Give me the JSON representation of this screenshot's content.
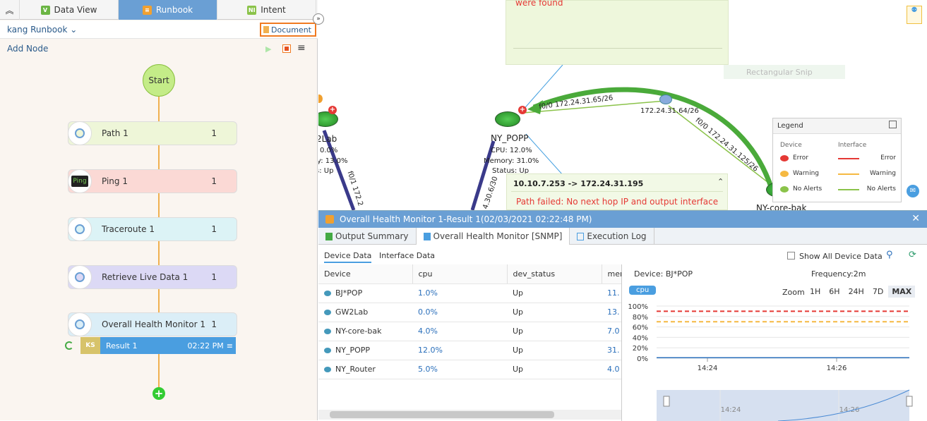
{
  "tabs": [
    {
      "label": "Data View",
      "icon": "V"
    },
    {
      "label": "Runbook",
      "icon": "≡"
    },
    {
      "label": "Intent",
      "icon": "NI"
    }
  ],
  "runbook": {
    "name": "kang Runbook",
    "document_label": "Document",
    "add_node_label": "Add Node",
    "start_label": "Start",
    "nodes": [
      {
        "label": "Path 1",
        "count": "1",
        "color": "#eef6d8",
        "icon": "path-icon"
      },
      {
        "label": "Ping 1",
        "count": "1",
        "color": "#fbd9d5",
        "icon": "ping-icon",
        "icon_text": "Ping"
      },
      {
        "label": "Traceroute 1",
        "count": "1",
        "color": "#dcf3f6",
        "icon": "traceroute-icon"
      },
      {
        "label": "Retrieve Live Data 1",
        "count": "1",
        "color": "#dcd9f5",
        "icon": "retrieve-data-icon"
      },
      {
        "label": "Overall Health Monitor 1",
        "count": "1",
        "color": "#dbeef7",
        "icon": "health-monitor-icon"
      }
    ],
    "result": {
      "badge": "KS",
      "label": "Result 1",
      "time": "02:22 PM"
    }
  },
  "map": {
    "note_text": "were found",
    "snip_text": "Rectangular Snip",
    "devices": [
      {
        "name": "2Lab",
        "cpu": "0.0%",
        "memory": "y: 13.0%",
        "status": "s: Up"
      },
      {
        "name": "NY_POPP",
        "cpu": "CPU: 12.0%",
        "memory": "Memory: 31.0%",
        "status": "Status: Up"
      },
      {
        "name": "NY-core-bak"
      }
    ],
    "link_labels": [
      "f0/0 172.24.31.65/26",
      "172.24.31.64/26",
      "f0/0 172.24.31.125/26",
      "f0/1 172.2",
      "4.30.6/30"
    ],
    "path_popup": {
      "title": "10.10.7.253 -> 172.24.31.195",
      "message": "Path failed: No next hop IP and output interface"
    },
    "legend": {
      "title": "Legend",
      "device_header": "Device",
      "interface_header": "Interface",
      "rows": [
        {
          "device": "Error",
          "interface": "Error",
          "color": "#e53935"
        },
        {
          "device": "Warning",
          "interface": "Warning",
          "color": "#f5b942"
        },
        {
          "device": "No Alerts",
          "interface": "No Alerts",
          "color": "#8bc34a"
        }
      ]
    }
  },
  "result_panel": {
    "title": "Overall Health Monitor 1-Result 1(02/03/2021 02:22:48 PM)",
    "tabs": [
      "Output Summary",
      "Overall Health Monitor [SNMP]",
      "Execution Log"
    ],
    "subtabs": [
      "Device Data",
      "Interface Data"
    ],
    "show_all_label": "Show All Device Data",
    "columns": [
      "Device",
      "cpu",
      "dev_status",
      "mer"
    ],
    "rows": [
      {
        "device": "BJ*POP",
        "cpu": "1.0%",
        "status": "Up",
        "mem": "11."
      },
      {
        "device": "GW2Lab",
        "cpu": "0.0%",
        "status": "Up",
        "mem": "13."
      },
      {
        "device": "NY-core-bak",
        "cpu": "4.0%",
        "status": "Up",
        "mem": "7.0"
      },
      {
        "device": "NY_POPP",
        "cpu": "12.0%",
        "status": "Up",
        "mem": "31."
      },
      {
        "device": "NY_Router",
        "cpu": "5.0%",
        "status": "Up",
        "mem": "4.0"
      }
    ],
    "chart": {
      "device_label": "Device: BJ*POP",
      "frequency_label": "Frequency:2m",
      "metric_badge": "cpu",
      "zoom_label": "Zoom",
      "zoom_options": [
        "1H",
        "6H",
        "24H",
        "7D",
        "MAX"
      ],
      "selected_zoom": "MAX",
      "y_ticks": [
        "100%",
        "80%",
        "60%",
        "40%",
        "20%",
        "0%"
      ],
      "x_ticks": [
        "14:24",
        "14:26"
      ],
      "navigator_ticks": [
        "14:24",
        "14:26"
      ]
    }
  },
  "chart_data": {
    "type": "line",
    "title": "",
    "ylim": [
      0,
      100
    ],
    "x": [
      "14:24",
      "14:26"
    ],
    "series": [
      {
        "values": [
          1,
          1
        ]
      }
    ],
    "thresholds": [
      {
        "value": 90,
        "color": "#e53935"
      },
      {
        "value": 70,
        "color": "#f5b942"
      }
    ]
  }
}
